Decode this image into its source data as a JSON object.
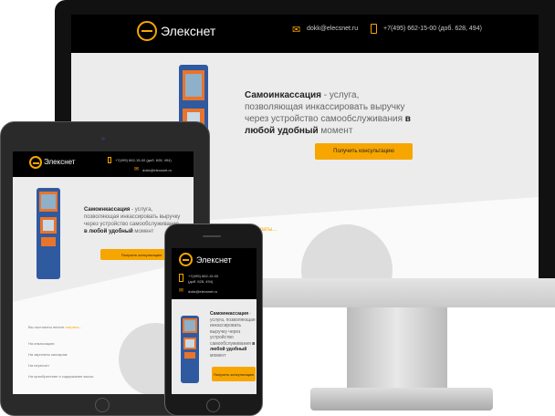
{
  "brand": "Элекснет",
  "email": "dokk@elecsnet.ru",
  "phone": "+7(495) 662-15-00 (доб. 628, 494)",
  "phone_short_1": "+7(495) 662-15-00",
  "phone_short_2": "(доб. 628, 494)",
  "hero": {
    "bold1": "Самоинкассация",
    "text1": " - услуга, позволяющая инкассировать выручку через устройство самообслуживания ",
    "bold2": "в любой удобный",
    "text2": " момент"
  },
  "cta": "Получить консультацию",
  "costs": {
    "lead": "Вы постоянно несете ",
    "accent": "затраты...",
    "items": [
      "На инкассацию",
      "На зарплаты кассирам",
      "На пересчет",
      "На приобретение и содержание кассы"
    ]
  },
  "colors": {
    "accent": "#f7a600",
    "header": "#000000",
    "kiosk": "#2f5aa0"
  },
  "icons": [
    "logo-icon",
    "mail-icon",
    "phone-icon"
  ]
}
